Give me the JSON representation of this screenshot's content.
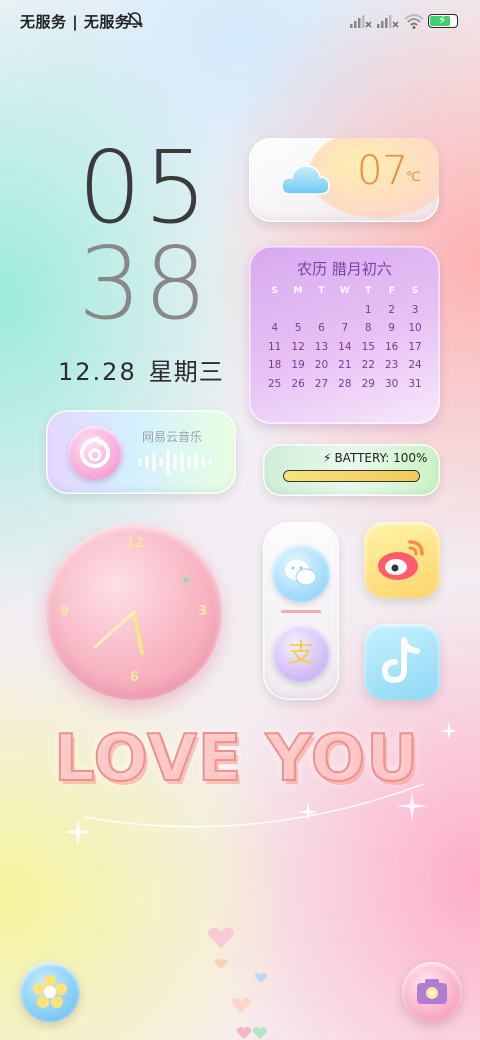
{
  "status_bar": {
    "carrier": "无服务 | 无服务",
    "icons": [
      "mute-bell-icon",
      "signal-icon",
      "signal-icon",
      "wifi-icon",
      "battery-charging-icon"
    ],
    "battery_level": 0.8,
    "battery_color": "#3fcf6e"
  },
  "clock": {
    "hour": "05",
    "minute": "38",
    "date": "12.28",
    "weekday": "星期三"
  },
  "weather": {
    "icon": "cloud-icon",
    "temperature": "07",
    "unit": "℃"
  },
  "calendar": {
    "title": "农历 腊月初六",
    "weekday_headers": [
      "S",
      "M",
      "T",
      "W",
      "T",
      "F",
      "S"
    ],
    "weeks": [
      [
        "",
        "",
        "",
        "",
        "1",
        "2",
        "3"
      ],
      [
        "4",
        "5",
        "6",
        "7",
        "8",
        "9",
        "10"
      ],
      [
        "11",
        "12",
        "13",
        "14",
        "15",
        "16",
        "17"
      ],
      [
        "18",
        "19",
        "20",
        "21",
        "22",
        "23",
        "24"
      ],
      [
        "25",
        "26",
        "27",
        "28",
        "29",
        "30",
        "31"
      ]
    ],
    "today": "28"
  },
  "music": {
    "title": "网易云音乐",
    "icon": "netease-music-icon"
  },
  "battery_widget": {
    "label": "BATTERY: 100%",
    "level": 1.0
  },
  "analog_clock": {
    "numerals": [
      "12",
      "3",
      "6",
      "9"
    ],
    "hour": 5,
    "minute": 38
  },
  "apps": {
    "wechat": "wechat-icon",
    "alipay": "alipay-icon",
    "weibo": "weibo-icon",
    "tiktok": "tiktok-icon"
  },
  "decor": {
    "headline": "LOVE YOU"
  },
  "dock": {
    "left": "flower-icon",
    "right": "camera-icon"
  }
}
